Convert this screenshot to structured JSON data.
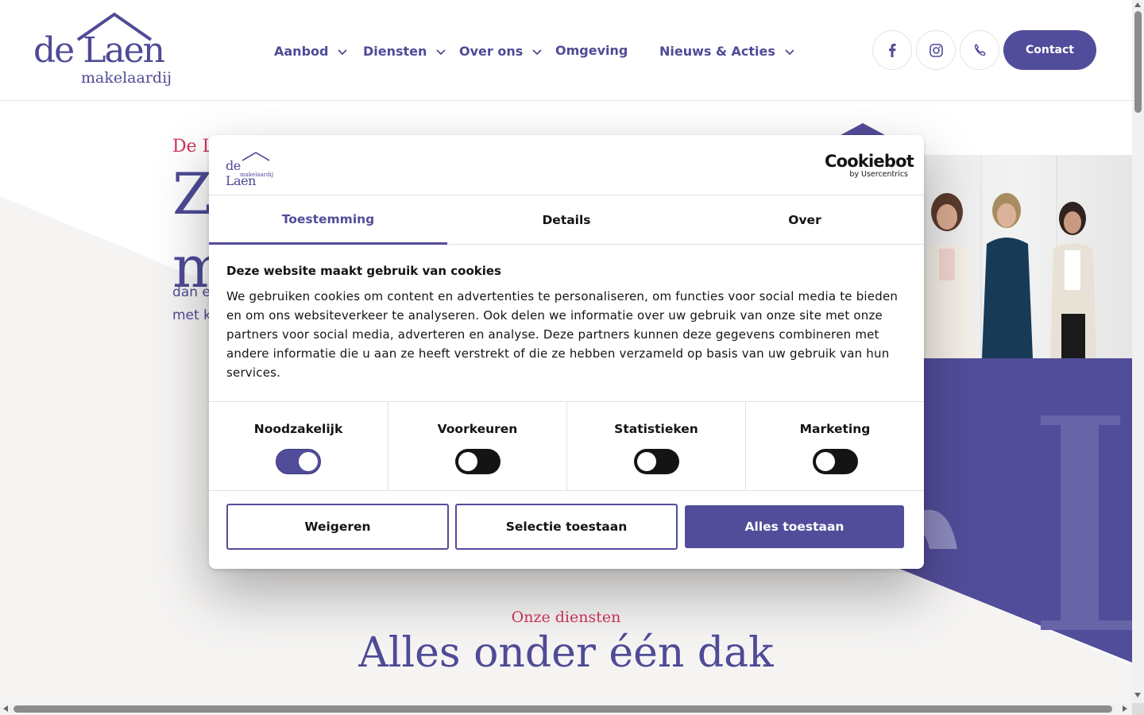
{
  "header": {
    "logo": {
      "word": "de Laen",
      "sub": "makelaardij"
    },
    "nav": [
      {
        "label": "Aanbod",
        "has_dropdown": true
      },
      {
        "label": "Diensten",
        "has_dropdown": true
      },
      {
        "label": "Over ons",
        "has_dropdown": true
      },
      {
        "label": "Omgeving",
        "has_dropdown": false
      },
      {
        "label": "Nieuws & Acties",
        "has_dropdown": true
      }
    ],
    "social_icons": [
      "facebook-icon",
      "instagram-icon",
      "phone-icon"
    ],
    "contact_label": "Contact"
  },
  "hero": {
    "kicker": "De L",
    "title_line1": "Ze",
    "title_line2": "m",
    "text_line1": "dan e",
    "text_line2": "met k"
  },
  "services": {
    "kicker": "Onze diensten",
    "title": "Alles onder één dak"
  },
  "cookie_dialog": {
    "logo": {
      "word": "de Laen",
      "sub": "makelaardij"
    },
    "brand": {
      "name": "Cookiebot",
      "by": "by Usercentrics"
    },
    "tabs": [
      {
        "label": "Toestemming",
        "active": true
      },
      {
        "label": "Details",
        "active": false
      },
      {
        "label": "Over",
        "active": false
      }
    ],
    "title": "Deze website maakt gebruik van cookies",
    "text": "We gebruiken cookies om content en advertenties te personaliseren, om functies voor social media te bieden en om ons websiteverkeer te analyseren. Ook delen we informatie over uw gebruik van onze site met onze partners voor social media, adverteren en analyse. Deze partners kunnen deze gegevens combineren met andere informatie die u aan ze heeft verstrekt of die ze hebben verzameld op basis van uw gebruik van hun services.",
    "toggles": [
      {
        "label": "Noodzakelijk",
        "on": true
      },
      {
        "label": "Voorkeuren",
        "on": false
      },
      {
        "label": "Statistieken",
        "on": false
      },
      {
        "label": "Marketing",
        "on": false
      }
    ],
    "buttons": {
      "reject": "Weigeren",
      "selection": "Selectie toestaan",
      "accept_all": "Alles toestaan"
    }
  },
  "colors": {
    "brand_purple": "#524d9a",
    "accent_red": "#d1335b",
    "text_dark": "#141414"
  }
}
